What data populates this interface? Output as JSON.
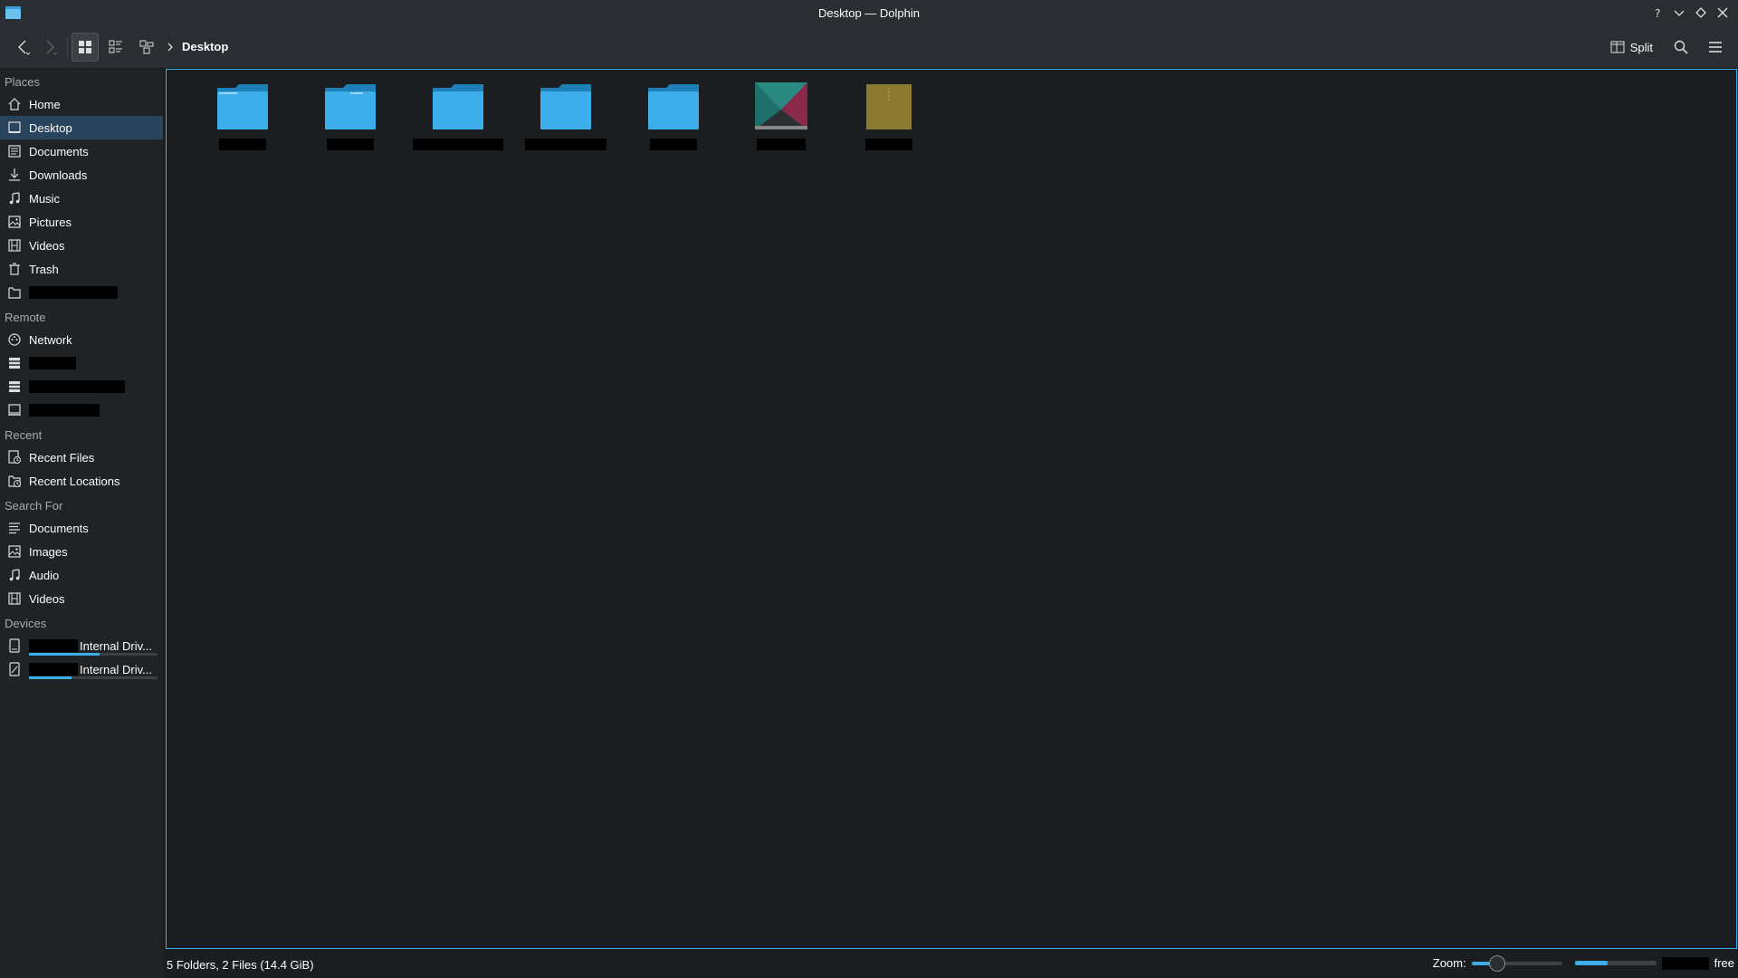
{
  "window": {
    "title": "Desktop — Dolphin"
  },
  "toolbar": {
    "breadcrumb": "Desktop",
    "split_label": "Split",
    "active_view": "icons"
  },
  "sidebar": {
    "places_title": "Places",
    "places": [
      {
        "label": "Home",
        "icon": "home-icon"
      },
      {
        "label": "Desktop",
        "icon": "desktop-icon",
        "selected": true
      },
      {
        "label": "Documents",
        "icon": "documents-icon"
      },
      {
        "label": "Downloads",
        "icon": "downloads-icon"
      },
      {
        "label": "Music",
        "icon": "music-icon"
      },
      {
        "label": "Pictures",
        "icon": "pictures-icon"
      },
      {
        "label": "Videos",
        "icon": "videos-icon"
      },
      {
        "label": "Trash",
        "icon": "trash-icon"
      }
    ],
    "remote_title": "Remote",
    "remote": [
      {
        "label": "Network",
        "icon": "network-icon"
      }
    ],
    "recent_title": "Recent",
    "recent": [
      {
        "label": "Recent Files",
        "icon": "recent-files-icon"
      },
      {
        "label": "Recent Locations",
        "icon": "recent-locations-icon"
      }
    ],
    "search_title": "Search For",
    "search": [
      {
        "label": "Documents",
        "icon": "search-documents-icon"
      },
      {
        "label": "Images",
        "icon": "search-images-icon"
      },
      {
        "label": "Audio",
        "icon": "search-audio-icon"
      },
      {
        "label": "Videos",
        "icon": "search-videos-icon"
      }
    ],
    "devices_title": "Devices",
    "devices": [
      {
        "label": "Internal Driv...",
        "icon": "drive-icon",
        "usage": 0.55
      },
      {
        "label": "Internal Driv...",
        "icon": "drive-icon",
        "usage": 0.33
      }
    ]
  },
  "main": {
    "items": [
      {
        "type": "folder"
      },
      {
        "type": "folder"
      },
      {
        "type": "folder"
      },
      {
        "type": "folder"
      },
      {
        "type": "folder"
      },
      {
        "type": "image"
      },
      {
        "type": "archive"
      }
    ]
  },
  "status": {
    "summary": "5 Folders, 2 Files (14.4 GiB)",
    "zoom_label": "Zoom:",
    "zoom_level": 0.28,
    "free_label": "free",
    "space_used": 0.4
  },
  "colors": {
    "accent": "#3daee9",
    "background": "#1b1e20",
    "sidebar": "#202326",
    "selection": "#29445d"
  }
}
